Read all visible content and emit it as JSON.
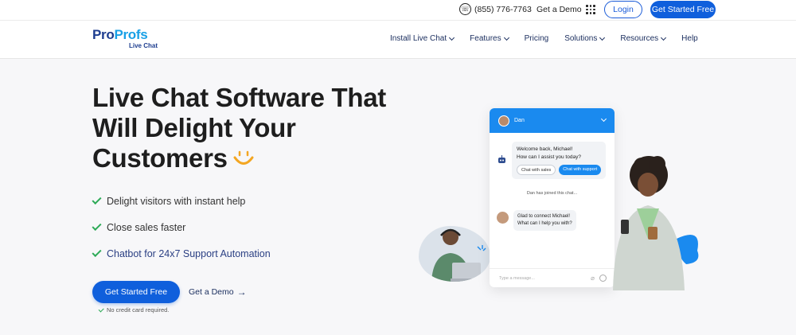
{
  "topbar": {
    "phone": "(855) 776-7763",
    "demo_label": "Get a Demo",
    "login_label": "Login",
    "cta_label": "Get Started Free"
  },
  "brand": {
    "logo_part1": "Pro",
    "logo_part2": "Profs",
    "logo_sub": "Live Chat"
  },
  "nav": {
    "items": [
      {
        "label": "Install Live Chat"
      },
      {
        "label": "Features"
      },
      {
        "label": "Pricing"
      },
      {
        "label": "Solutions"
      },
      {
        "label": "Resources"
      },
      {
        "label": "Help"
      }
    ]
  },
  "hero": {
    "title": "Live Chat Software That Will Delight Your Customers",
    "features": [
      "Delight visitors with instant help",
      "Close sales faster",
      "Chatbot for 24x7 Support Automation"
    ],
    "cta_label": "Get Started Free",
    "demo_label": "Get a Demo",
    "note": "No credit card required."
  },
  "chat_widget": {
    "agent_name": "Dan",
    "bot_message_1": "Welcome back, Michael!",
    "bot_message_2": "How can I assist you today?",
    "quick_reply_1": "Chat with sales",
    "quick_reply_2": "Chat with support",
    "system_message": "Dan has joined this chat...",
    "agent_message_1": "Glad to connect Michael!",
    "agent_message_2": "What can I help you with?",
    "input_placeholder": "Type a message..."
  },
  "colors": {
    "primary": "#0f5fdc",
    "chat_header": "#1a8aef",
    "check": "#2daa57",
    "brand_dark": "#1d3d8f",
    "brand_light": "#18a0e6"
  }
}
